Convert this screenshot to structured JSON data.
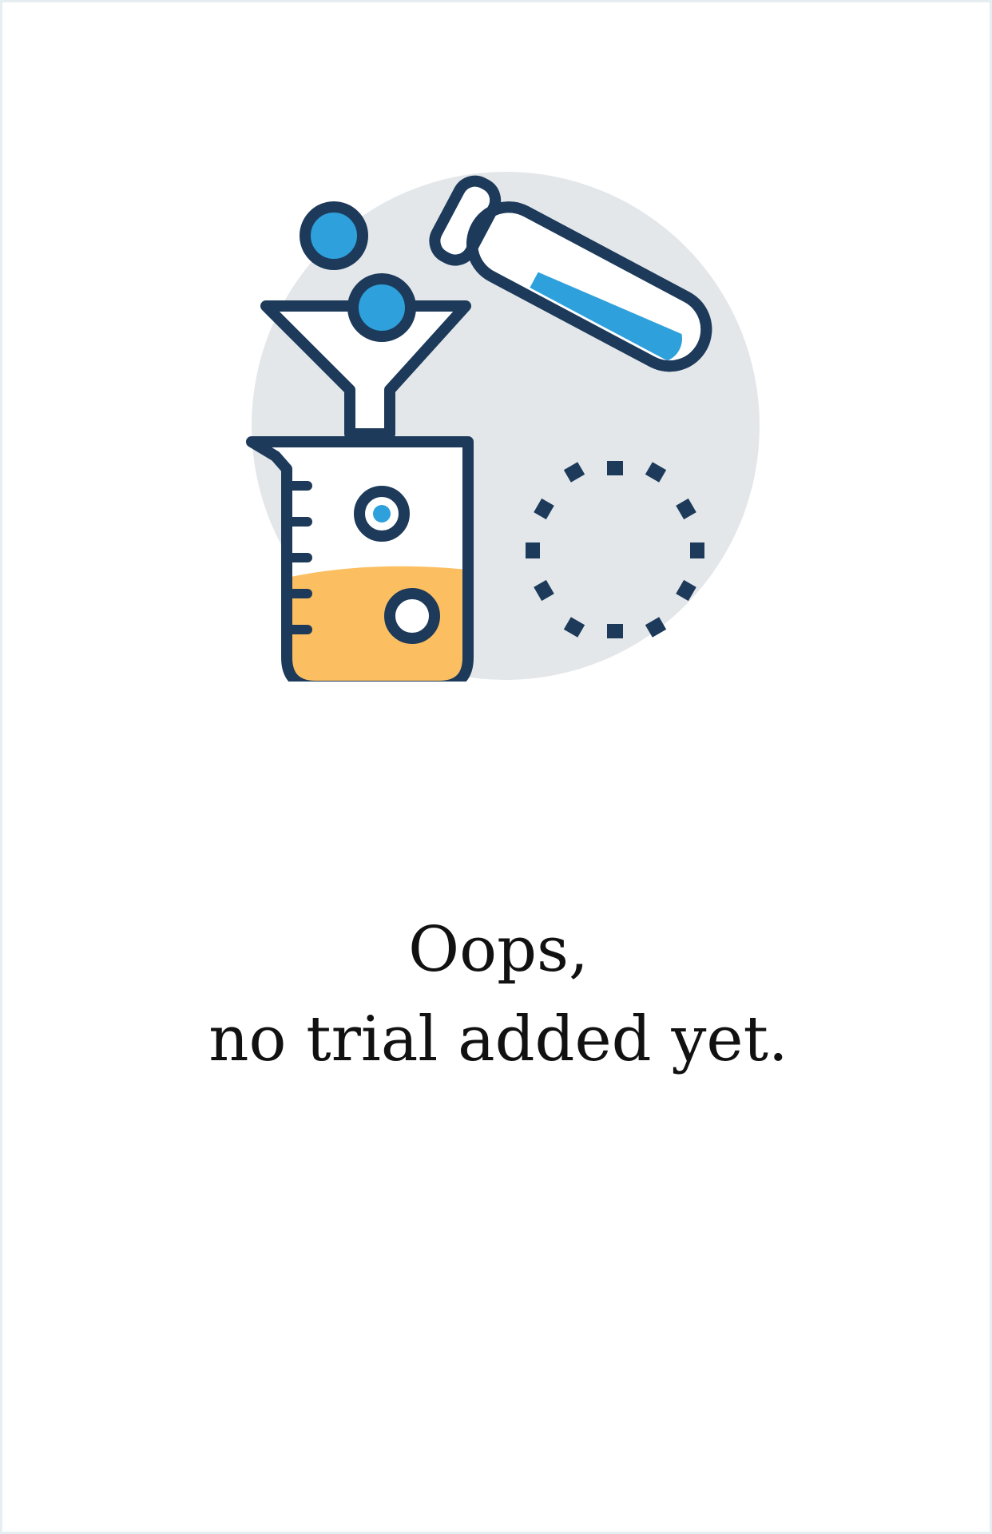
{
  "empty_state": {
    "illustration_icon": "lab-experiment-icon",
    "heading": "Oops,",
    "subheading": "no trial added yet."
  },
  "colors": {
    "outline": "#1d3a5a",
    "accent_blue": "#2ea0dc",
    "liquid_orange": "#fbbf62",
    "backdrop_gray": "#e3e7ea",
    "text": "#111111"
  }
}
